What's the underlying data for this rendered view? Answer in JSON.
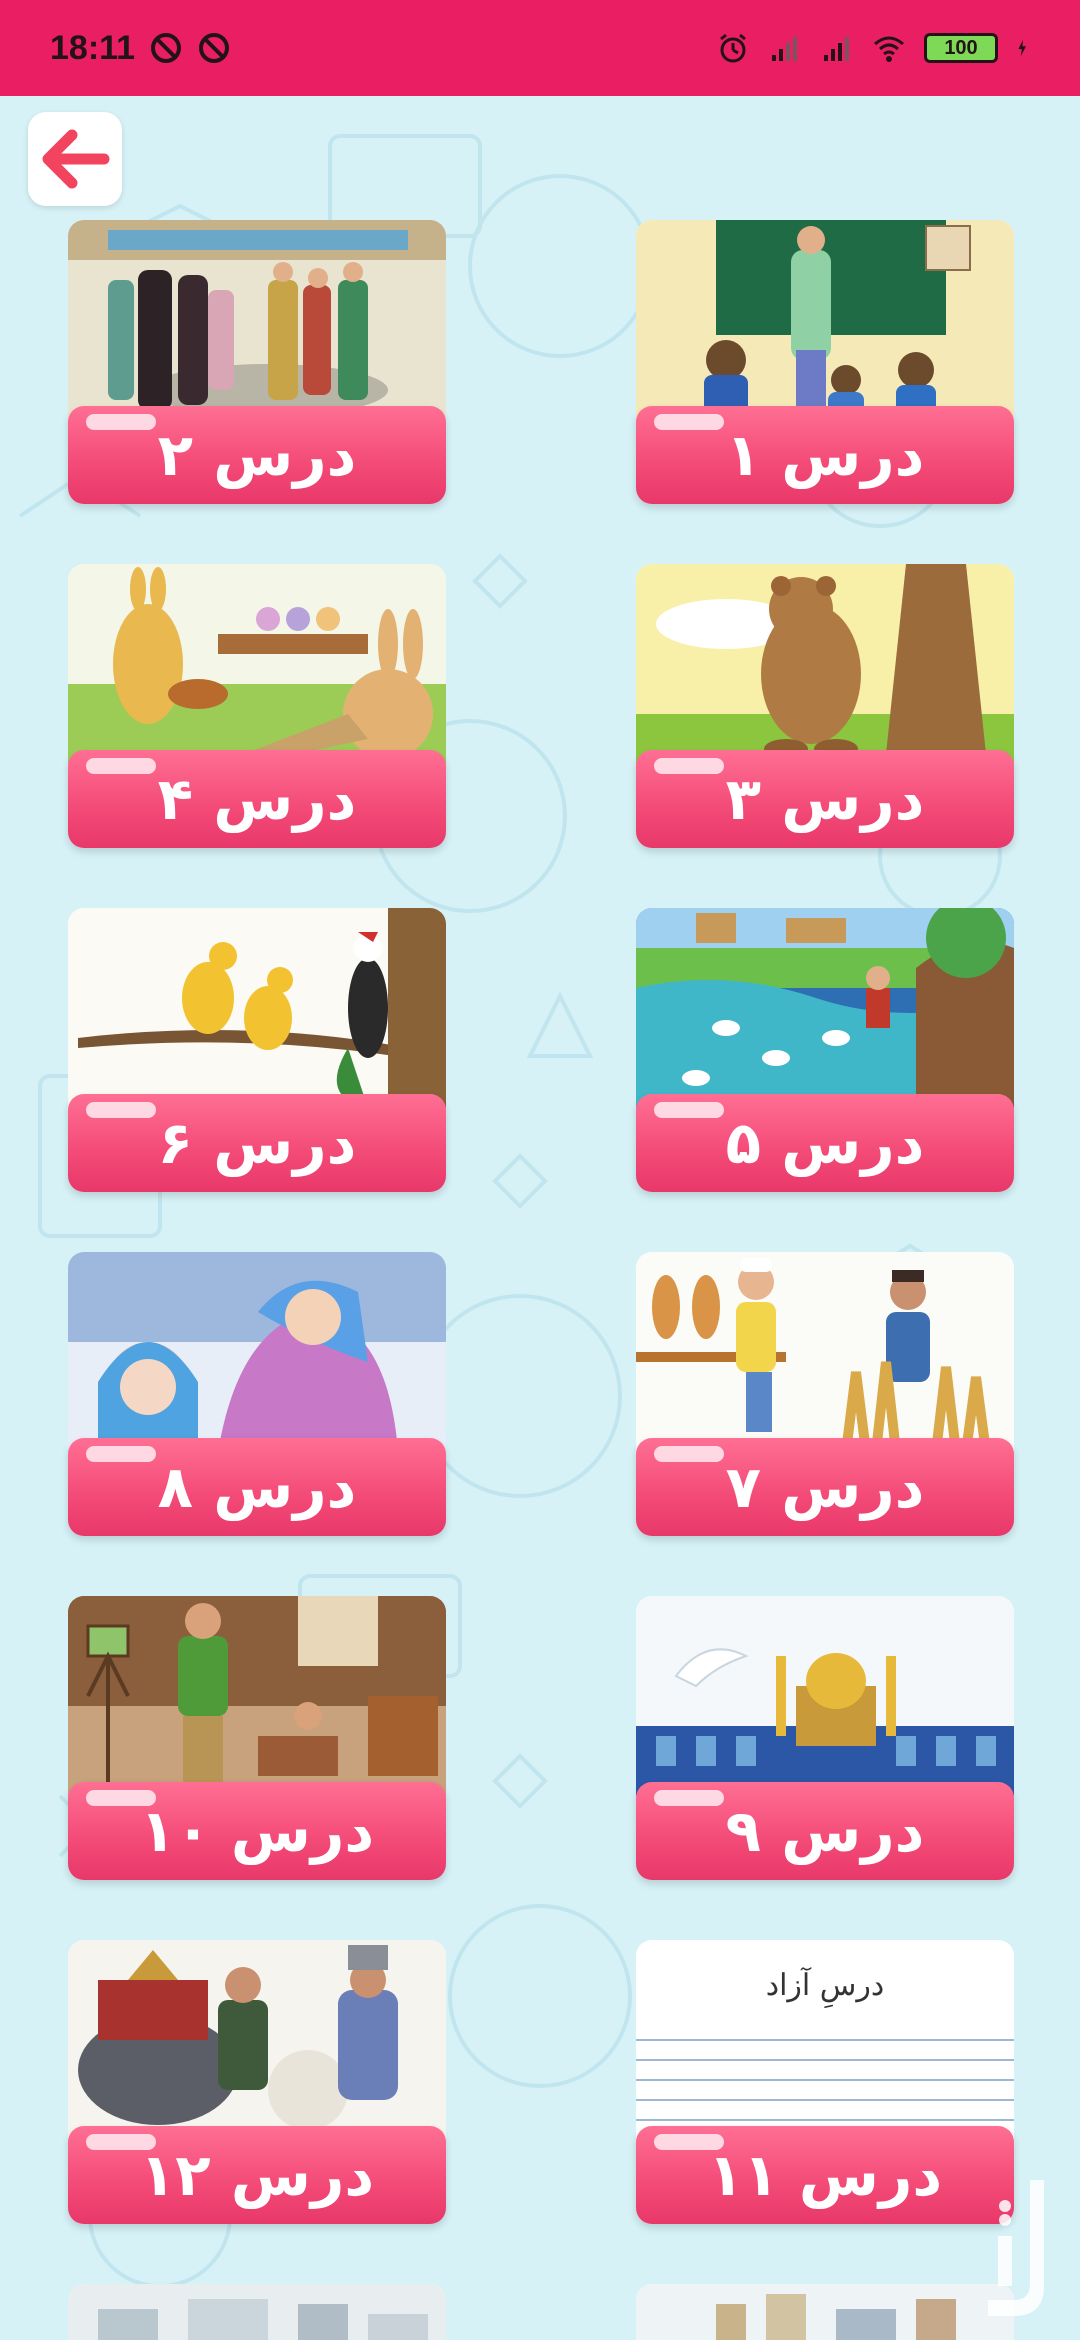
{
  "status_bar": {
    "time": "18:11",
    "battery": "100",
    "icons": [
      "no-disturb-icon",
      "no-disturb-icon",
      "alarm-icon",
      "signal-icon",
      "signal-icon",
      "wifi-icon",
      "battery-icon",
      "charging-icon"
    ]
  },
  "colors": {
    "status_bar": "#e91e63",
    "background": "#d6f2f7",
    "label": "#f34a77",
    "back_arrow": "#f2435f"
  },
  "back_button": {
    "icon": "back-arrow-icon"
  },
  "lessons": [
    {
      "label": "درس ۱",
      "scene": "teacher-classroom"
    },
    {
      "label": "درس ۲",
      "scene": "family-visit"
    },
    {
      "label": "درس ۳",
      "scene": "bear-tree"
    },
    {
      "label": "درس ۴",
      "scene": "rabbits-class"
    },
    {
      "label": "درس ۵",
      "scene": "flood-river"
    },
    {
      "label": "درس ۶",
      "scene": "birds-branch"
    },
    {
      "label": "درس ۷",
      "scene": "baker-farmer"
    },
    {
      "label": "درس ۸",
      "scene": "mother-child"
    },
    {
      "label": "درس ۹",
      "scene": "dove-shrine"
    },
    {
      "label": "درس ۱۰",
      "scene": "room-family"
    },
    {
      "label": "درس ۱۱",
      "scene": "free-lesson-page",
      "image_text": "درسِ آزاد"
    },
    {
      "label": "درس ۱۲",
      "scene": "epic-warriors"
    }
  ]
}
